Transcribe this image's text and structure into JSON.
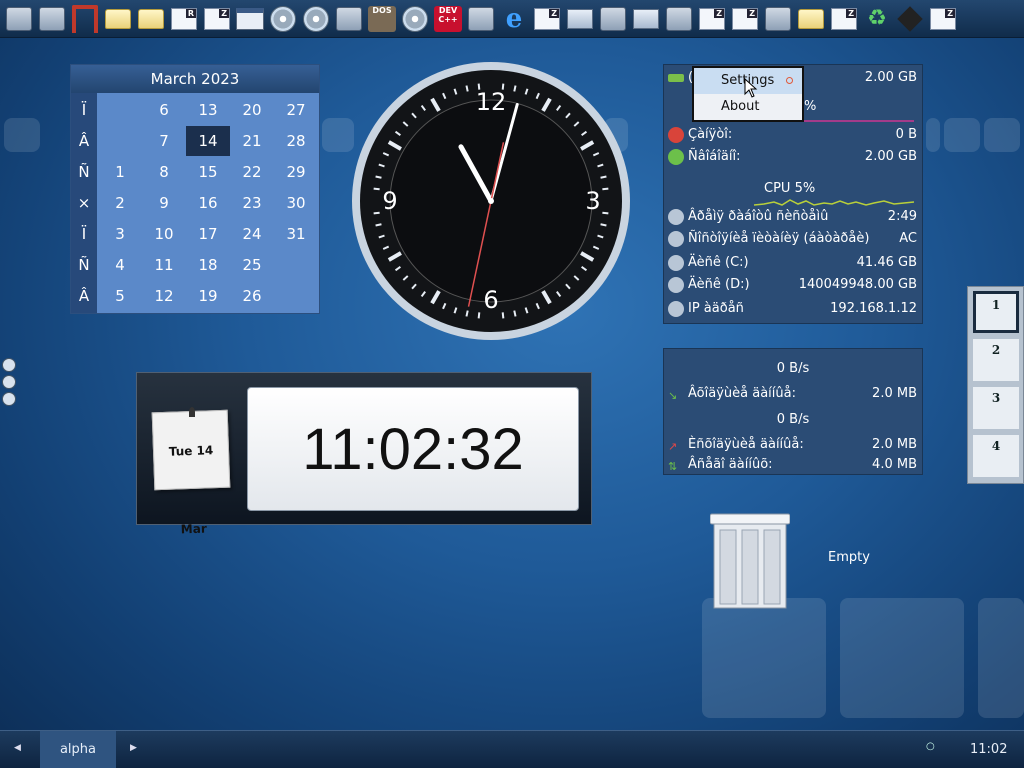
{
  "launcher": {
    "items": [
      {
        "icon": "terminal-icon"
      },
      {
        "icon": "terminal-icon"
      },
      {
        "icon": "app-icon"
      },
      {
        "icon": "folder-icon"
      },
      {
        "icon": "folder-icon"
      },
      {
        "icon": "r-document-icon",
        "label": "R"
      },
      {
        "icon": "z-document-icon",
        "label": "Z"
      },
      {
        "icon": "window-icon"
      },
      {
        "icon": "disc-icon"
      },
      {
        "icon": "cd-icon"
      },
      {
        "icon": "atom-icon"
      },
      {
        "icon": "dosbox-icon",
        "label": "DOS"
      },
      {
        "icon": "disc-tool-icon"
      },
      {
        "icon": "devcpp-icon",
        "label": "DEV C++"
      },
      {
        "icon": "network-tool-icon"
      },
      {
        "icon": "internet-explorer-icon",
        "label": "e"
      },
      {
        "icon": "z-document-icon",
        "label": "Z"
      },
      {
        "icon": "computer-icon"
      },
      {
        "icon": "mail-icon"
      },
      {
        "icon": "monitor-icon"
      },
      {
        "icon": "raccoon-icon"
      },
      {
        "icon": "z-document-icon",
        "label": "Z"
      },
      {
        "icon": "z-document-icon",
        "label": "Z"
      },
      {
        "icon": "chart-tool-icon"
      },
      {
        "icon": "folder-icon"
      },
      {
        "icon": "z-document-icon",
        "label": "Z"
      },
      {
        "icon": "recycle-icon"
      },
      {
        "icon": "cube-icon"
      },
      {
        "icon": "z-document-icon",
        "label": "Z"
      }
    ]
  },
  "calendar": {
    "title": "March 2023",
    "day_names": [
      "Ï",
      "Â",
      "Ñ",
      "×",
      "Ï",
      "Ñ",
      "Â"
    ],
    "weeks": [
      [
        "",
        "",
        "1",
        "2",
        "3",
        "4",
        "5"
      ],
      [
        "6",
        "7",
        "8",
        "9",
        "10",
        "11",
        "12"
      ],
      [
        "13",
        "14",
        "15",
        "16",
        "17",
        "18",
        "19"
      ],
      [
        "20",
        "21",
        "22",
        "23",
        "24",
        "25",
        "26"
      ],
      [
        "27",
        "28",
        "29",
        "30",
        "31",
        "",
        ""
      ]
    ],
    "today": "14"
  },
  "analog_clock": {
    "numerals": [
      "12",
      "3",
      "6",
      "9"
    ],
    "hour": 11,
    "minute": 2,
    "second": 32
  },
  "digital_clock": {
    "date": "Tue 14 Mar",
    "time": "11:02:32"
  },
  "system_monitor": {
    "memory_label": "( ... ì:",
    "memory_value": "2.00 GB",
    "memory_percent_tail": "%",
    "rows": [
      {
        "icon": "stop-icon",
        "label": "Çàíÿòî:",
        "value": "0 B",
        "color": "#d9443a"
      },
      {
        "icon": "check-icon",
        "label": "Ñâîáîäíî:",
        "value": "2.00 GB",
        "color": "#6cc04a"
      }
    ],
    "cpu_label": "CPU 5%",
    "rows2": [
      {
        "icon": "clock-icon",
        "label": "Âðåìÿ ðàáîòû ñèñòåìû",
        "value": "2:49"
      },
      {
        "icon": "power-plug-icon",
        "label": "Ñîñòîÿíèå ïèòàíèÿ (áàòàðåè)",
        "value": "AC"
      },
      {
        "icon": "drive-icon",
        "label": "Äèñê (C:)",
        "value": "41.46 GB"
      },
      {
        "icon": "drive-icon",
        "label": "Äèñê (D:)",
        "value": "140049948.00 GB"
      },
      {
        "icon": "network-icon",
        "label": "IP àäðåñ",
        "value": "192.168.1.12"
      }
    ]
  },
  "context_menu": {
    "items": [
      "Settings",
      "About"
    ]
  },
  "network_monitor": {
    "speed1": "0 B/s",
    "row1": {
      "icon": "download-arrow-icon",
      "label": "Âõîäÿùèå äàííûå:",
      "value": "2.0 MB"
    },
    "speed2": "0 B/s",
    "row2": {
      "icon": "upload-arrow-icon",
      "label": "Èñõîäÿùèå äàííûå:",
      "value": "2.0 MB"
    },
    "row3": {
      "icon": "total-arrows-icon",
      "label": "Âñåãî äàííûõ:",
      "value": "4.0 MB"
    }
  },
  "pager": {
    "pages": [
      "1",
      "2",
      "3",
      "4"
    ],
    "active": "1"
  },
  "trash": {
    "label": "Empty"
  },
  "taskbar": {
    "task_label": "alpha",
    "time": "11:02"
  }
}
